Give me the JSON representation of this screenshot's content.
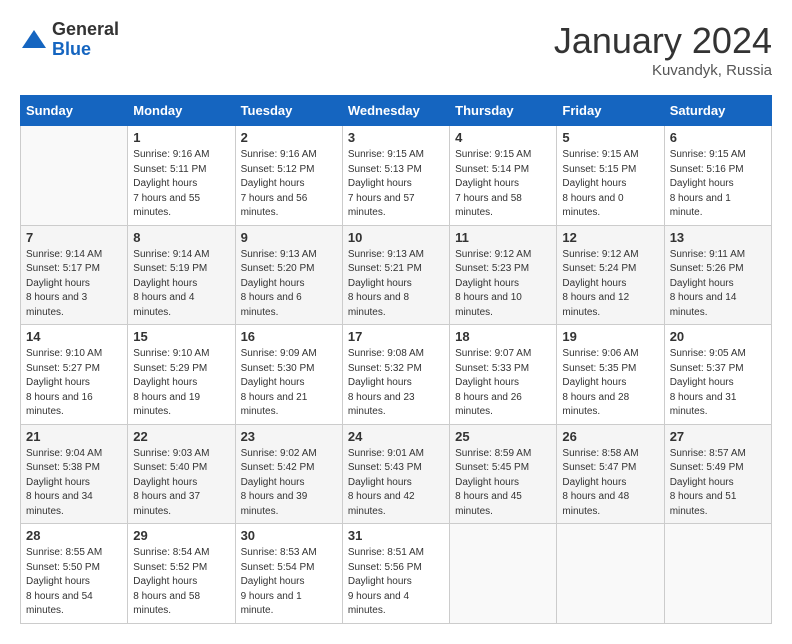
{
  "header": {
    "logo": {
      "line1": "General",
      "line2": "Blue"
    },
    "title": "January 2024",
    "subtitle": "Kuvandyk, Russia"
  },
  "weekdays": [
    "Sunday",
    "Monday",
    "Tuesday",
    "Wednesday",
    "Thursday",
    "Friday",
    "Saturday"
  ],
  "weeks": [
    [
      null,
      {
        "day": 1,
        "sunrise": "9:16 AM",
        "sunset": "5:11 PM",
        "daylight": "7 hours and 55 minutes."
      },
      {
        "day": 2,
        "sunrise": "9:16 AM",
        "sunset": "5:12 PM",
        "daylight": "7 hours and 56 minutes."
      },
      {
        "day": 3,
        "sunrise": "9:15 AM",
        "sunset": "5:13 PM",
        "daylight": "7 hours and 57 minutes."
      },
      {
        "day": 4,
        "sunrise": "9:15 AM",
        "sunset": "5:14 PM",
        "daylight": "7 hours and 58 minutes."
      },
      {
        "day": 5,
        "sunrise": "9:15 AM",
        "sunset": "5:15 PM",
        "daylight": "8 hours and 0 minutes."
      },
      {
        "day": 6,
        "sunrise": "9:15 AM",
        "sunset": "5:16 PM",
        "daylight": "8 hours and 1 minute."
      }
    ],
    [
      {
        "day": 7,
        "sunrise": "9:14 AM",
        "sunset": "5:17 PM",
        "daylight": "8 hours and 3 minutes."
      },
      {
        "day": 8,
        "sunrise": "9:14 AM",
        "sunset": "5:19 PM",
        "daylight": "8 hours and 4 minutes."
      },
      {
        "day": 9,
        "sunrise": "9:13 AM",
        "sunset": "5:20 PM",
        "daylight": "8 hours and 6 minutes."
      },
      {
        "day": 10,
        "sunrise": "9:13 AM",
        "sunset": "5:21 PM",
        "daylight": "8 hours and 8 minutes."
      },
      {
        "day": 11,
        "sunrise": "9:12 AM",
        "sunset": "5:23 PM",
        "daylight": "8 hours and 10 minutes."
      },
      {
        "day": 12,
        "sunrise": "9:12 AM",
        "sunset": "5:24 PM",
        "daylight": "8 hours and 12 minutes."
      },
      {
        "day": 13,
        "sunrise": "9:11 AM",
        "sunset": "5:26 PM",
        "daylight": "8 hours and 14 minutes."
      }
    ],
    [
      {
        "day": 14,
        "sunrise": "9:10 AM",
        "sunset": "5:27 PM",
        "daylight": "8 hours and 16 minutes."
      },
      {
        "day": 15,
        "sunrise": "9:10 AM",
        "sunset": "5:29 PM",
        "daylight": "8 hours and 19 minutes."
      },
      {
        "day": 16,
        "sunrise": "9:09 AM",
        "sunset": "5:30 PM",
        "daylight": "8 hours and 21 minutes."
      },
      {
        "day": 17,
        "sunrise": "9:08 AM",
        "sunset": "5:32 PM",
        "daylight": "8 hours and 23 minutes."
      },
      {
        "day": 18,
        "sunrise": "9:07 AM",
        "sunset": "5:33 PM",
        "daylight": "8 hours and 26 minutes."
      },
      {
        "day": 19,
        "sunrise": "9:06 AM",
        "sunset": "5:35 PM",
        "daylight": "8 hours and 28 minutes."
      },
      {
        "day": 20,
        "sunrise": "9:05 AM",
        "sunset": "5:37 PM",
        "daylight": "8 hours and 31 minutes."
      }
    ],
    [
      {
        "day": 21,
        "sunrise": "9:04 AM",
        "sunset": "5:38 PM",
        "daylight": "8 hours and 34 minutes."
      },
      {
        "day": 22,
        "sunrise": "9:03 AM",
        "sunset": "5:40 PM",
        "daylight": "8 hours and 37 minutes."
      },
      {
        "day": 23,
        "sunrise": "9:02 AM",
        "sunset": "5:42 PM",
        "daylight": "8 hours and 39 minutes."
      },
      {
        "day": 24,
        "sunrise": "9:01 AM",
        "sunset": "5:43 PM",
        "daylight": "8 hours and 42 minutes."
      },
      {
        "day": 25,
        "sunrise": "8:59 AM",
        "sunset": "5:45 PM",
        "daylight": "8 hours and 45 minutes."
      },
      {
        "day": 26,
        "sunrise": "8:58 AM",
        "sunset": "5:47 PM",
        "daylight": "8 hours and 48 minutes."
      },
      {
        "day": 27,
        "sunrise": "8:57 AM",
        "sunset": "5:49 PM",
        "daylight": "8 hours and 51 minutes."
      }
    ],
    [
      {
        "day": 28,
        "sunrise": "8:55 AM",
        "sunset": "5:50 PM",
        "daylight": "8 hours and 54 minutes."
      },
      {
        "day": 29,
        "sunrise": "8:54 AM",
        "sunset": "5:52 PM",
        "daylight": "8 hours and 58 minutes."
      },
      {
        "day": 30,
        "sunrise": "8:53 AM",
        "sunset": "5:54 PM",
        "daylight": "9 hours and 1 minute."
      },
      {
        "day": 31,
        "sunrise": "8:51 AM",
        "sunset": "5:56 PM",
        "daylight": "9 hours and 4 minutes."
      },
      null,
      null,
      null
    ]
  ]
}
